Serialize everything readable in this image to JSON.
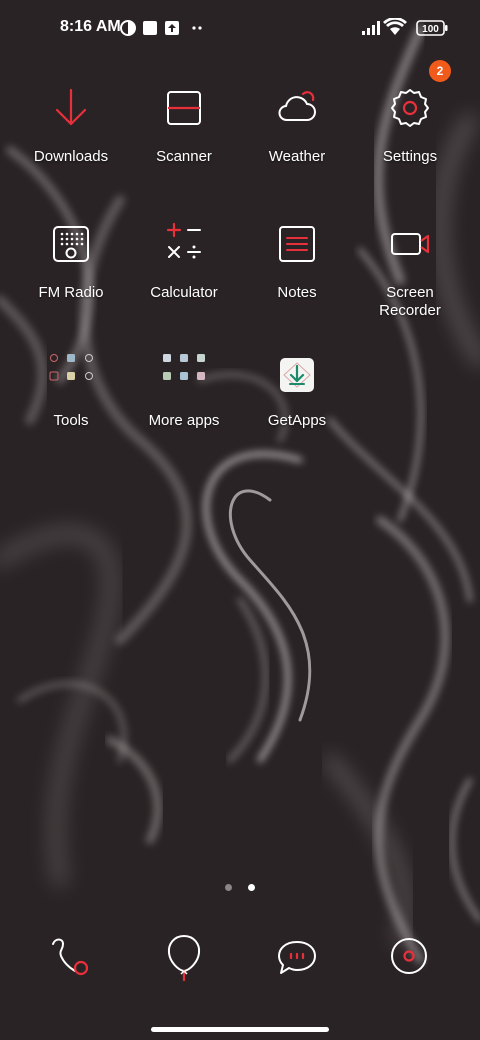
{
  "status_bar": {
    "time": "8:16 AM",
    "battery": "100",
    "notification_icons": [
      "data-saver-icon",
      "square-app-icon",
      "upload-icon",
      "more-dots-icon"
    ],
    "system_icons": [
      "signal-icon",
      "wifi-icon",
      "battery-icon"
    ]
  },
  "apps": [
    {
      "label": "Downloads",
      "icon": "download-arrow-icon"
    },
    {
      "label": "Scanner",
      "icon": "scanner-icon"
    },
    {
      "label": "Weather",
      "icon": "cloud-icon"
    },
    {
      "label": "Settings",
      "icon": "gear-icon",
      "badge": "2"
    },
    {
      "label": "FM Radio",
      "icon": "radio-icon"
    },
    {
      "label": "Calculator",
      "icon": "calculator-icon"
    },
    {
      "label": "Notes",
      "icon": "notes-icon"
    },
    {
      "label": "Screen\nRecorder",
      "icon": "video-camera-icon"
    },
    {
      "label": "Tools",
      "icon": "folder-grid-icon"
    },
    {
      "label": "More apps",
      "icon": "folder-grid-icon"
    },
    {
      "label": "GetApps",
      "icon": "getapps-icon"
    }
  ],
  "page_indicator": {
    "pages": 2,
    "current": 2
  },
  "dock": [
    {
      "icon": "phone-icon"
    },
    {
      "icon": "browser-balloon-icon"
    },
    {
      "icon": "messages-icon"
    },
    {
      "icon": "camera-icon"
    }
  ],
  "colors": {
    "accent": "#e8303a",
    "badge": "#f05a1a",
    "background": "#2a2325"
  }
}
